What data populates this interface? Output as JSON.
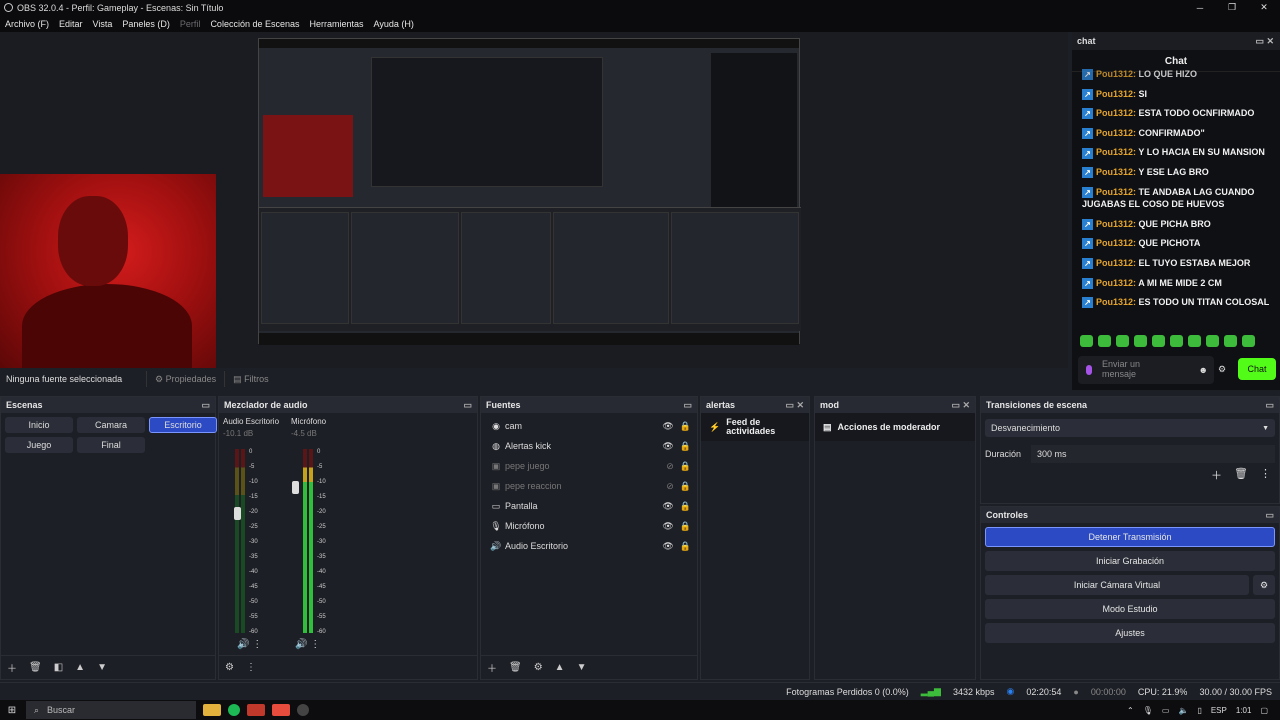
{
  "window": {
    "title": "OBS 32.0.4 - Perfil: Gameplay - Escenas: Sin Título",
    "minimize_icon": "─",
    "maximize_icon": "❐",
    "close_icon": "✕"
  },
  "menu": [
    {
      "label": "Archivo (F)",
      "enabled": true
    },
    {
      "label": "Editar",
      "enabled": true
    },
    {
      "label": "Vista",
      "enabled": true
    },
    {
      "label": "Paneles (D)",
      "enabled": true
    },
    {
      "label": "Perfil",
      "enabled": false
    },
    {
      "label": "Colección de Escenas",
      "enabled": true
    },
    {
      "label": "Herramientas",
      "enabled": true
    },
    {
      "label": "Ayuda (H)",
      "enabled": true
    }
  ],
  "properties_bar": {
    "no_source": "Ninguna fuente seleccionada",
    "properties": "Propiedades",
    "filters": "Filtros"
  },
  "chat": {
    "dock_title": "chat",
    "title": "Chat",
    "messages": [
      {
        "user": "Pou1312",
        "text": "LO QUE HIZO"
      },
      {
        "user": "Pou1312",
        "text": "SI"
      },
      {
        "user": "Pou1312",
        "text": "ESTA TODO OCNFIRMADO"
      },
      {
        "user": "Pou1312",
        "text": "CONFIRMADO\""
      },
      {
        "user": "Pou1312",
        "text": "Y LO HACIA EN SU MANSION"
      },
      {
        "user": "Pou1312",
        "text": "Y ESE LAG BRO"
      },
      {
        "user": "Pou1312",
        "text": "TE ANDABA LAG CUANDO JUGABAS EL COSO DE HUEVOS"
      },
      {
        "user": "Pou1312",
        "text": "QUE PICHA BRO"
      },
      {
        "user": "Pou1312",
        "text": "QUE PICHOTA"
      },
      {
        "user": "Pou1312",
        "text": "EL TUYO ESTABA MEJOR"
      },
      {
        "user": "Pou1312",
        "text": "A MI ME MIDE 2 CM"
      },
      {
        "user": "Pou1312",
        "text": "ES TODO UN TITAN COLOSAL"
      }
    ],
    "input_placeholder": "Enviar un mensaje",
    "send_label": "Chat",
    "accent": "#53fc18"
  },
  "scenes": {
    "title": "Escenas",
    "items": [
      {
        "label": "Inicio",
        "active": false
      },
      {
        "label": "Camara",
        "active": false
      },
      {
        "label": "Escritorio",
        "active": true
      },
      {
        "label": "Juego",
        "active": false
      },
      {
        "label": "Final",
        "active": false
      }
    ]
  },
  "mixer": {
    "title": "Mezclador de audio",
    "channels": [
      {
        "name": "Audio Escritorio",
        "db": "-10.1 dB"
      },
      {
        "name": "Micrófono",
        "db": "-4.5 dB"
      }
    ],
    "scale": [
      "0",
      "-5",
      "-10",
      "-15",
      "-20",
      "-25",
      "-30",
      "-35",
      "-40",
      "-45",
      "-50",
      "-55",
      "-60"
    ]
  },
  "sources": {
    "title": "Fuentes",
    "items": [
      {
        "label": "cam",
        "icon": "◉",
        "visible": true
      },
      {
        "label": "Alertas kick",
        "icon": "◍",
        "visible": true
      },
      {
        "label": "pepe juego",
        "icon": "▣",
        "visible": false
      },
      {
        "label": "pepe reaccion",
        "icon": "▣",
        "visible": false
      },
      {
        "label": "Pantalla",
        "icon": "▭",
        "visible": true
      },
      {
        "label": "Micrófono",
        "icon": "🎙",
        "visible": true
      },
      {
        "label": "Audio Escritorio",
        "icon": "🔊",
        "visible": true
      }
    ]
  },
  "alerts": {
    "title": "alertas",
    "feed": "Feed de actividades"
  },
  "mod": {
    "title": "mod",
    "actions": "Acciones de moderador"
  },
  "transitions": {
    "title": "Transiciones de escena",
    "selected": "Desvanecimiento",
    "duration_label": "Duración",
    "duration_value": "300 ms"
  },
  "controls": {
    "title": "Controles",
    "buttons": [
      {
        "label": "Detener Transmisión",
        "primary": true
      },
      {
        "label": "Iniciar Grabación",
        "primary": false
      },
      {
        "label": "Iniciar Cámara Virtual",
        "primary": false
      },
      {
        "label": "Modo Estudio",
        "primary": false
      },
      {
        "label": "Ajustes",
        "primary": false
      }
    ]
  },
  "status": {
    "dropped": "Fotogramas Perdidos 0 (0.0%)",
    "bitrate": "3432 kbps",
    "stream_time": "02:20:54",
    "rec_time": "00:00:00",
    "cpu": "CPU: 21.9%",
    "fps": "30.00 / 30.00 FPS"
  },
  "taskbar": {
    "search": "Buscar",
    "lang": "ESP",
    "time": "1:01"
  }
}
